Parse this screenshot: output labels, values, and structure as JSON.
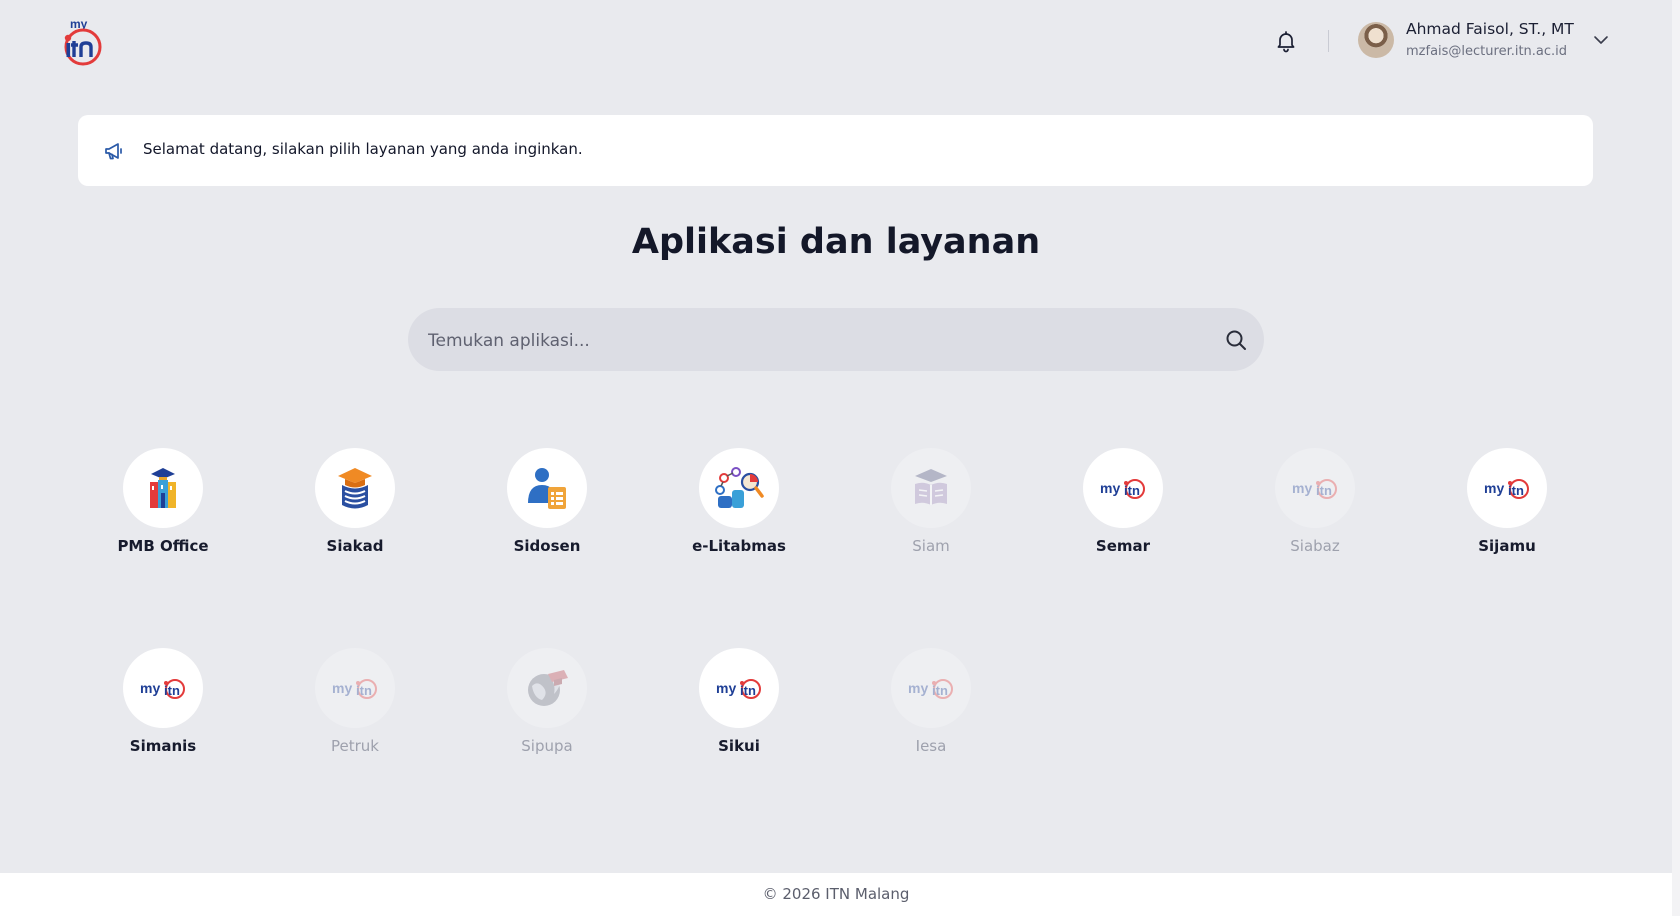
{
  "header": {
    "logo_icon": "myitn-logo",
    "notification_icon": "bell-icon",
    "user": {
      "name": "Ahmad Faisol, ST., MT",
      "email": "mzfais@lecturer.itn.ac.id",
      "menu_icon": "chevron-down-icon"
    }
  },
  "banner": {
    "icon": "megaphone-icon",
    "text": "Selamat datang, silakan pilih layanan yang anda inginkan."
  },
  "main": {
    "title": "Aplikasi dan layanan",
    "search": {
      "placeholder": "Temukan aplikasi...",
      "value": "",
      "icon": "search-icon"
    },
    "apps": [
      {
        "label": "PMB Office",
        "icon": "pmb-office-icon",
        "enabled": true
      },
      {
        "label": "Siakad",
        "icon": "siakad-icon",
        "enabled": true
      },
      {
        "label": "Sidosen",
        "icon": "sidosen-icon",
        "enabled": true
      },
      {
        "label": "e-Litabmas",
        "icon": "e-litabmas-icon",
        "enabled": true
      },
      {
        "label": "Siam",
        "icon": "siam-icon",
        "enabled": false
      },
      {
        "label": "Semar",
        "icon": "myitn-logo-icon",
        "enabled": true
      },
      {
        "label": "Siabaz",
        "icon": "myitn-logo-icon",
        "enabled": false
      },
      {
        "label": "Sijamu",
        "icon": "myitn-logo-icon",
        "enabled": true
      },
      {
        "label": "Simanis",
        "icon": "myitn-logo-icon",
        "enabled": true
      },
      {
        "label": "Petruk",
        "icon": "myitn-logo-icon",
        "enabled": false
      },
      {
        "label": "Sipupa",
        "icon": "sipupa-icon",
        "enabled": false
      },
      {
        "label": "Sikui",
        "icon": "myitn-logo-icon",
        "enabled": true
      },
      {
        "label": "Iesa",
        "icon": "myitn-logo-icon",
        "enabled": false
      }
    ]
  },
  "footer": {
    "text": "© 2026 ITN Malang"
  },
  "colors": {
    "background": "#e9eaee",
    "brand_blue": "#1f3f96",
    "brand_red": "#e33b3b",
    "accent_orange": "#f08a24"
  }
}
